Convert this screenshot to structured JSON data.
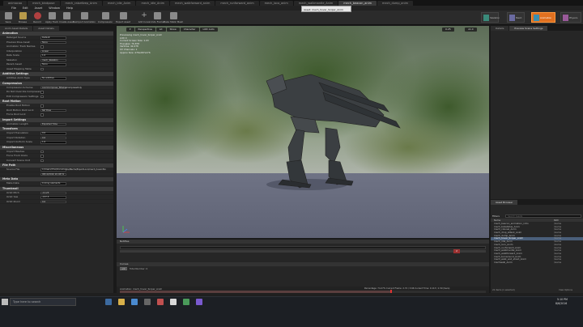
{
  "tabs": [
    "animacao",
    "mech_bindpose",
    "mech_raiseKeep_Anim",
    "mech_idle_Anim",
    "mech_idle_Anim",
    "mech_walkforward_anim",
    "mech_runforward_anim",
    "mech_loco_anim",
    "mech_walkmantle_Anim",
    "mech_beacon_anim",
    "mech_dump_anim"
  ],
  "menu": [
    "File",
    "Edit",
    "Asset",
    "Window",
    "Help"
  ],
  "toolbar": {
    "buttons": [
      "Save",
      "Browse",
      "Record",
      "Apply Track",
      "Create Asset",
      "Reimport Animation",
      "Compression",
      "Export Asset",
      "Add Curve",
      "Undo Frame",
      "Make Static Mesh"
    ],
    "tooltip": "Asset: mech_hover_Sniper_Anim",
    "modes": [
      "Skeleton",
      "Mesh",
      "Animation",
      "Physics"
    ]
  },
  "details": {
    "tabs": [
      "Anim Asset Details",
      "Asset Details"
    ],
    "sections": [
      {
        "title": "Animation",
        "rows": [
          {
            "label": "Retarget Source",
            "value": "Default"
          },
          {
            "label": "Preview Pose Asset",
            "value": "None"
          },
          {
            "label": "Animation Track Names",
            "value": ""
          },
          {
            "label": "Interpolation",
            "value": "Linear"
          },
          {
            "label": "Rate Scale",
            "value": "1.0"
          },
          {
            "label": "Skeleton",
            "value": "mech_Skeleton"
          },
          {
            "label": "Parent Asset",
            "value": "None"
          },
          {
            "label": "Asset Mapping Table",
            "value": ""
          }
        ]
      },
      {
        "title": "Additive Settings",
        "rows": [
          {
            "label": "Additive Anim Type",
            "value": "No additive"
          }
        ]
      },
      {
        "title": "Compression",
        "rows": [
          {
            "label": "Compression Scheme",
            "value": "AnimCompress_BitwiseCompressOnly"
          },
          {
            "label": "Do Not Override Compression",
            "value": ""
          },
          {
            "label": "Edit Compression Settings",
            "value": ""
          }
        ]
      },
      {
        "title": "Root Motion",
        "rows": [
          {
            "label": "Enable Root Motion",
            "value": ""
          },
          {
            "label": "Root Motion Root Lock",
            "value": "Ref Pose"
          },
          {
            "label": "Force Root Lock",
            "value": ""
          }
        ]
      },
      {
        "title": "Import Settings",
        "rows": [
          {
            "label": "Animation Length",
            "value": "Exported Time"
          }
        ]
      },
      {
        "title": "Transform",
        "rows": [
          {
            "label": "Import Translation",
            "value": "0.0"
          },
          {
            "label": "Import Rotation",
            "value": "0.0"
          },
          {
            "label": "Import Uniform Scale",
            "value": "1.0"
          }
        ]
      },
      {
        "title": "Miscellaneous",
        "rows": [
          {
            "label": "Import Meshes",
            "value": ""
          },
          {
            "label": "Force Front XAxis",
            "value": ""
          },
          {
            "label": "Convert Scene Unit",
            "value": ""
          }
        ]
      },
      {
        "title": "File Path",
        "rows": [
          {
            "label": "Source File",
            "value": "C:/Users/Tiho/Documents/Mechs/ExportLoco/mech_hover.fbx"
          },
          {
            "label": "",
            "value": "08/10/2016 20:08:51"
          }
        ]
      },
      {
        "title": "Meta Data",
        "rows": [
          {
            "label": "Meta Data",
            "value": "0 Array elements"
          }
        ]
      },
      {
        "title": "Thumbnail",
        "rows": [
          {
            "label": "Orbit Pitch",
            "value": "-11.25"
          },
          {
            "label": "Orbit Yaw",
            "value": "-157.5"
          },
          {
            "label": "Orbit Zoom",
            "value": "0.0"
          }
        ]
      }
    ]
  },
  "viewport": {
    "buttons": [
      "Perspective",
      "Lit",
      "Show",
      "Character",
      "LOD Auto"
    ],
    "speed": "x1.0",
    "fov": "0.25",
    "info": [
      "Previewing mech_hover_Sniper_Anim",
      "LOD 0",
      "Current Screen Size: 1.03",
      "Triangles: 76,878",
      "Vertices: 42,478",
      "UV Channels: 1",
      "Approx Size: 476x287x276"
    ]
  },
  "timeline": {
    "notifies_label": "Notifies",
    "curves_label": "Curves",
    "add_label": "Add",
    "total_label": "Total Number: 0",
    "playback_label": "Animation: mech_hover_Sniper_Anim",
    "percentage": "Percentage: 74.27%  Current Frame: 2.72 / 3.66  Current Time: 0.113 / 1.50 (Secs)",
    "frame_marker": "2"
  },
  "right_top": {
    "title": "Preview Scene Settings",
    "tabs": [
      "Details",
      "Preview Scene Settings"
    ]
  },
  "asset_browser": {
    "title": "Asset Browser",
    "filters_label": "Filters",
    "search_placeholder": "Search Assets",
    "col_name": "Name",
    "col_path": "Path",
    "items": [
      {
        "name": "mech_beacon_animation_intro",
        "path": "/Game"
      },
      {
        "name": "mech_bobstatue_Anim",
        "path": "/Game"
      },
      {
        "name": "mech_colonel_Anim",
        "path": "/Game"
      },
      {
        "name": "mech_drop_attack_Anim",
        "path": "/Game"
      },
      {
        "name": "mech_dump_Anim",
        "path": "/Game"
      },
      {
        "name": "mech_hover_Sniper_Anim",
        "path": "/Game"
      },
      {
        "name": "mech_idle_Anim",
        "path": "/Game"
      },
      {
        "name": "mech_loco_Anim",
        "path": "/Game"
      },
      {
        "name": "mech_runforward_Anim",
        "path": "/Game"
      },
      {
        "name": "mech_walkmantle_Anim",
        "path": "/Game"
      },
      {
        "name": "mech_walkforward_Anim",
        "path": "/Game"
      },
      {
        "name": "mech_turnaround_Anim",
        "path": "/Game"
      },
      {
        "name": "mech_walk_and_shoot_Anim",
        "path": "/Game"
      },
      {
        "name": "mechwalk_Anim",
        "path": "/Game"
      }
    ],
    "selected_index": 5,
    "count": "22 items (1 selected)",
    "view_options": "View Options"
  },
  "taskbar": {
    "search_placeholder": "Type here to search",
    "time": "5:10 PM",
    "date": "8/6/2016"
  }
}
